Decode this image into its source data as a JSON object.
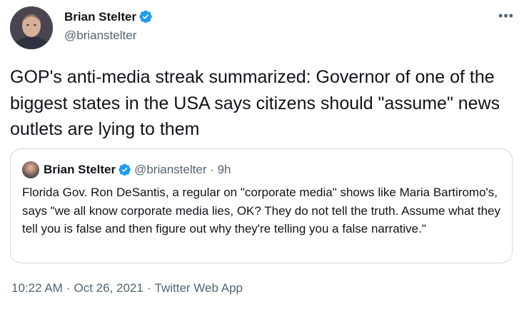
{
  "author": {
    "name": "Brian Stelter",
    "handle": "@brianstelter",
    "verified": true
  },
  "tweet": {
    "text": "GOP's anti-media streak summarized: Governor of one of the biggest states in the USA says citizens should \"assume\" news outlets are lying to them"
  },
  "quote": {
    "name": "Brian Stelter",
    "handle": "@brianstelter",
    "time": "9h",
    "text": "Florida Gov. Ron DeSantis, a regular on \"corporate media\" shows like Maria Bartiromo's, says \"we all know corporate media lies, OK? They do not tell the truth. Assume what they tell you is false and then figure out why they're telling you a false narrative.\""
  },
  "footer": {
    "time": "10:22 AM",
    "date": "Oct 26, 2021",
    "source": "Twitter Web App"
  },
  "icons": {
    "verified": "verified-badge-icon",
    "more": "more-horizontal-icon"
  },
  "colors": {
    "text_primary": "#0f1419",
    "text_secondary": "#536471",
    "verified_blue": "#1d9bf0",
    "border": "#cfd9de"
  }
}
